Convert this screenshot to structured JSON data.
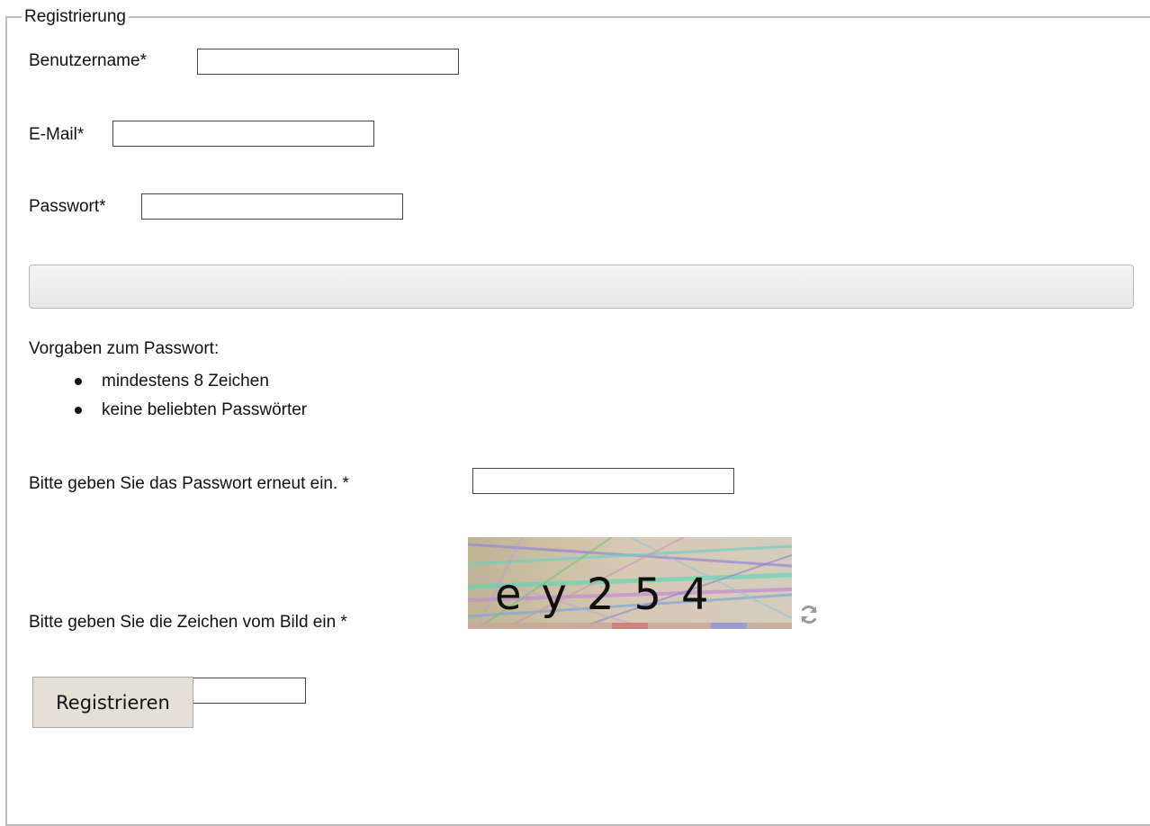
{
  "form": {
    "legend": "Registrierung",
    "username_label": "Benutzername*",
    "username_value": "",
    "email_label": "E-Mail*",
    "email_value": "",
    "password_label": "Passwort*",
    "password_value": "",
    "password_rules_title": "Vorgaben zum Passwort:",
    "password_rules": [
      "mindestens 8 Zeichen",
      "keine beliebten Passwörter"
    ],
    "password_repeat_label": "Bitte geben Sie das Passwort erneut ein. *",
    "password_repeat_value": "",
    "captcha_label": "Bitte geben Sie die Zeichen vom Bild ein *",
    "captcha_text": "ey254",
    "captcha_input_value": "",
    "submit_label": "Registrieren"
  },
  "icons": {
    "refresh": "refresh-icon"
  },
  "colors": {
    "fieldset_border": "#bdbdbd",
    "button_background": "#e4e0d8",
    "strength_meter": "#eeeeee"
  }
}
